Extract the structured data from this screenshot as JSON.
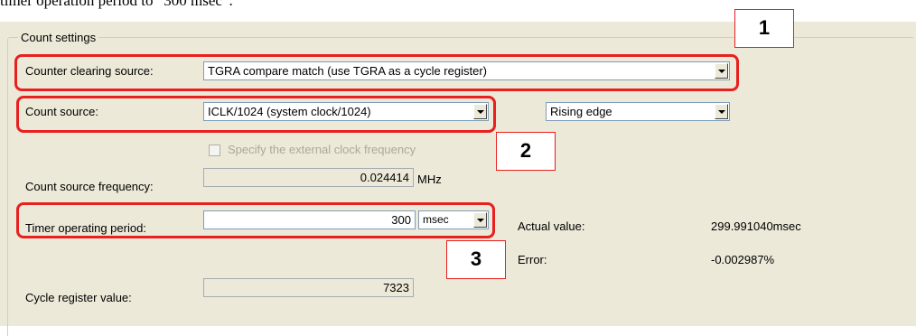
{
  "doc_text": "timer operation period to “300 msec”.",
  "group": {
    "title": "Count settings"
  },
  "clearing": {
    "label": "Counter clearing source:",
    "value": "TGRA compare match (use TGRA as a cycle register)"
  },
  "source": {
    "label": "Count source:",
    "value": "ICLK/1024 (system clock/1024)",
    "edge_value": "Rising edge"
  },
  "external": {
    "label": "Specify the external clock frequency",
    "checked": false
  },
  "frequency": {
    "label": "Count source frequency:",
    "value": "0.024414",
    "unit": "MHz"
  },
  "period": {
    "label": "Timer operating period:",
    "value": "300",
    "unit": "msec",
    "actual_label": "Actual value:",
    "actual_value": "299.991040msec",
    "error_label": "Error:",
    "error_value": "-0.002987%"
  },
  "cycle": {
    "label": "Cycle register value:",
    "value": "7323"
  },
  "callouts": [
    "1",
    "2",
    "3"
  ],
  "colors": {
    "highlight": "#e8201f",
    "dialog_bg": "#ece9d8"
  }
}
